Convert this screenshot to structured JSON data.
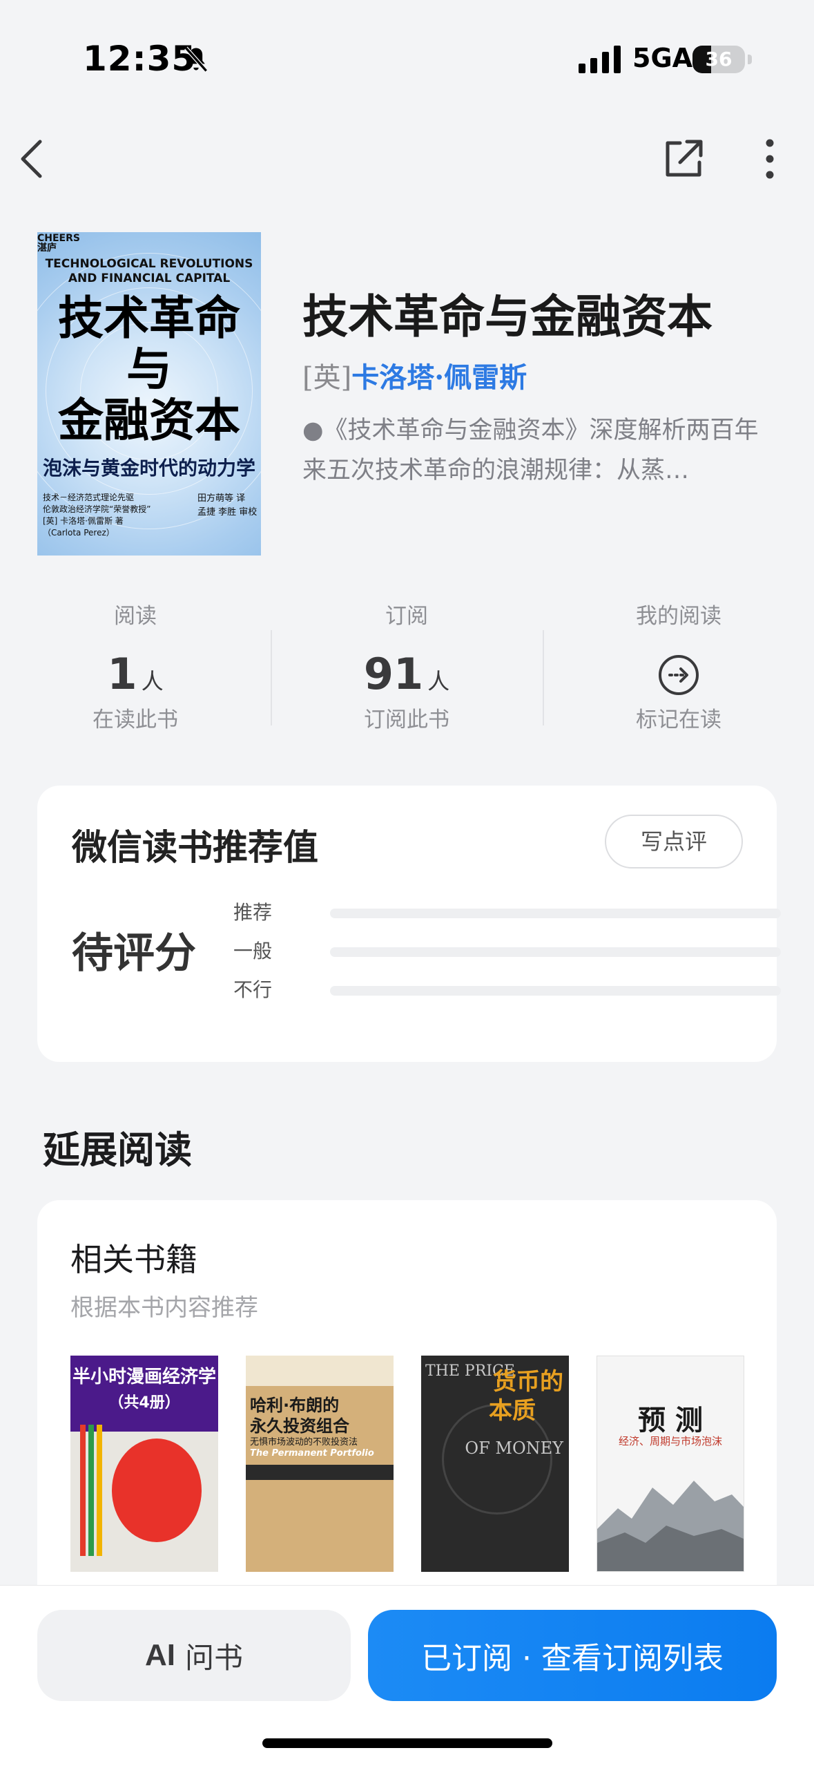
{
  "status_bar": {
    "time": "12:35",
    "network": "5GA",
    "battery": "36",
    "battery_level": 0.36,
    "icons": [
      "bell-slash-icon",
      "signal-icon",
      "battery-icon"
    ]
  },
  "nav": {
    "icons": [
      "back-icon",
      "share-icon",
      "more-icon"
    ]
  },
  "book": {
    "cover": {
      "publisher": "CHEERS\n湛庐",
      "english_title": "TECHNOLOGICAL REVOLUTIONS\nAND FINANCIAL CAPITAL",
      "title": "技术革命\n与\n金融资本",
      "subtitle": "泡沫与黄金时代的动力学",
      "meta_left": "技术－经济范式理论先驱\n伦敦政治经济学院“荣誉教授”\n[英] 卡洛塔·佩雷斯 著\n（Carlota Perez）",
      "meta_right": "田方萌等 译\n孟捷 李胜 审校"
    },
    "title": "技术革命与金融资本",
    "author_prefix": "[英]",
    "author": "卡洛塔·佩雷斯",
    "description": "●《技术革命与金融资本》深度解析两百年来五次技术革命的浪潮规律：从蒸…"
  },
  "stats": {
    "reading": {
      "label": "阅读",
      "value": "1",
      "unit": "人",
      "caption": "在读此书"
    },
    "subscribe": {
      "label": "订阅",
      "value": "91",
      "unit": "人",
      "caption": "订阅此书"
    },
    "my_reading": {
      "label": "我的阅读",
      "icon": "arrow-right-circle-icon",
      "caption": "标记在读"
    }
  },
  "rating": {
    "title": "微信读书推荐值",
    "review_button": "写点评",
    "status": "待评分",
    "rows": [
      {
        "label": "推荐",
        "value": 0
      },
      {
        "label": "一般",
        "value": 0
      },
      {
        "label": "不行",
        "value": 0
      }
    ]
  },
  "extended": {
    "section_title": "延展阅读",
    "related_title": "相关书籍",
    "related_subtitle": "根据本书内容推荐",
    "books": [
      {
        "line1": "半小时漫画经济学",
        "line2": "（共4册）",
        "color": "#4b1a8a"
      },
      {
        "line1": "哈利·布朗的",
        "line2": "永久投资组合",
        "line3": "无惧市场波动的不败投资法",
        "en": "The Permanent Portfolio",
        "color": "#d4b07a"
      },
      {
        "line1": "货币的",
        "line2": "本质",
        "en1": "THE PRICE",
        "en2": "OF MONEY",
        "color": "#2a2a2a"
      },
      {
        "line1": "预 测",
        "line2": "经济、周期与市场泡沫",
        "color": "#f5f5f5"
      }
    ]
  },
  "bottom": {
    "ask_icon": "AI",
    "ask_label": "问书",
    "subscribe_label": "已订阅 · 查看订阅列表"
  }
}
